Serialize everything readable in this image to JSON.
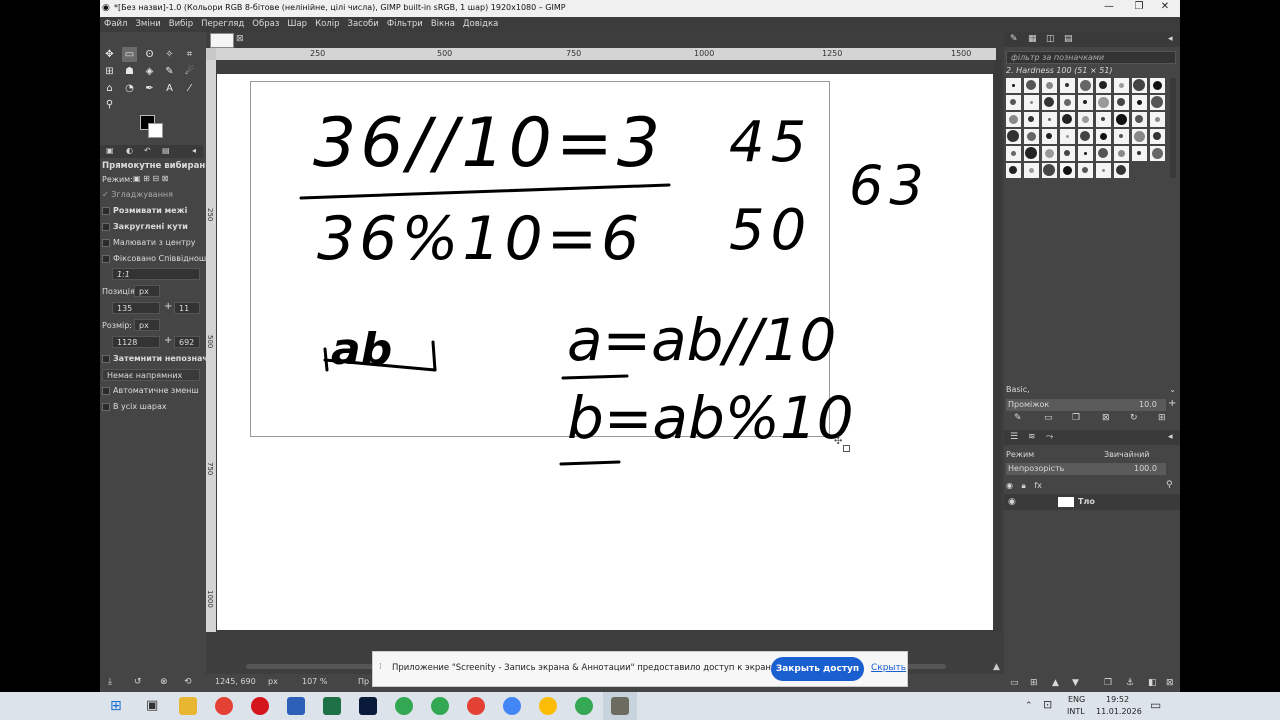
{
  "window": {
    "title": "*[Без назви]-1.0 (Кольори RGB 8-бітове (нелінійне, цілі числа), GIMP built-in sRGB, 1 шар) 1920x1080 – GIMP"
  },
  "menu": [
    "Файл",
    "Зміни",
    "Вибір",
    "Перегляд",
    "Образ",
    "Шар",
    "Колір",
    "Засоби",
    "Фільтри",
    "Вікна",
    "Довідка"
  ],
  "tool_options": {
    "title": "Прямокутне вибирання",
    "mode_label": "Режим:",
    "antialias": "Згладжування",
    "feather": "Розмивати межі",
    "rounded": "Закруглені кути",
    "from_center": "Малювати з центру",
    "fixed": "Фіксовано Співвіднош",
    "ratio": "1:1",
    "position_label": "Позиція",
    "position_unit": "px",
    "pos_x": "135",
    "pos_y": "11",
    "size_label": "Розмір:",
    "size_unit": "px",
    "size_w": "1128",
    "size_h": "692",
    "darken": "Затемнити непозначе",
    "guides": "Немає напрямних",
    "autoshrink": "Автоматичне зменш",
    "all_layers": "В усіх шарах"
  },
  "ruler": {
    "h": [
      "250",
      "500",
      "750",
      "1000",
      "1250",
      "1500"
    ],
    "v": [
      "250",
      "500",
      "750",
      "1000"
    ]
  },
  "status": {
    "coords": "1245, 690",
    "unit": "px",
    "zoom": "107 %",
    "msg": "Пр"
  },
  "handwriting": {
    "l1": "36//10=3",
    "l2": "36%10=6",
    "n45": "45",
    "n50": "50",
    "n63": "63",
    "ab": "ab",
    "a_eq": "a=ab//10",
    "b_eq": "b=ab%10"
  },
  "right_panel": {
    "filter_placeholder": "фільтр за позначками",
    "brush_name": "2. Hardness 100 (51 × 51)",
    "preset": "Basic,",
    "spacing_label": "Проміжок",
    "spacing_value": "10.0",
    "mode_label": "Режим",
    "mode_value": "Звичайний",
    "opacity_label": "Непрозорість",
    "opacity_value": "100.0",
    "layer_name": "Тло"
  },
  "notification": {
    "text": "Приложение \"Screenity - Запись экрана & Аннотации\" предоставило доступ к экрану и аудио.",
    "button": "Закрыть доступ",
    "link": "Скрыть"
  },
  "taskbar": {
    "lang1": "ENG",
    "lang2": "INTL",
    "time": "19:52",
    "date": "11.01.2026"
  }
}
